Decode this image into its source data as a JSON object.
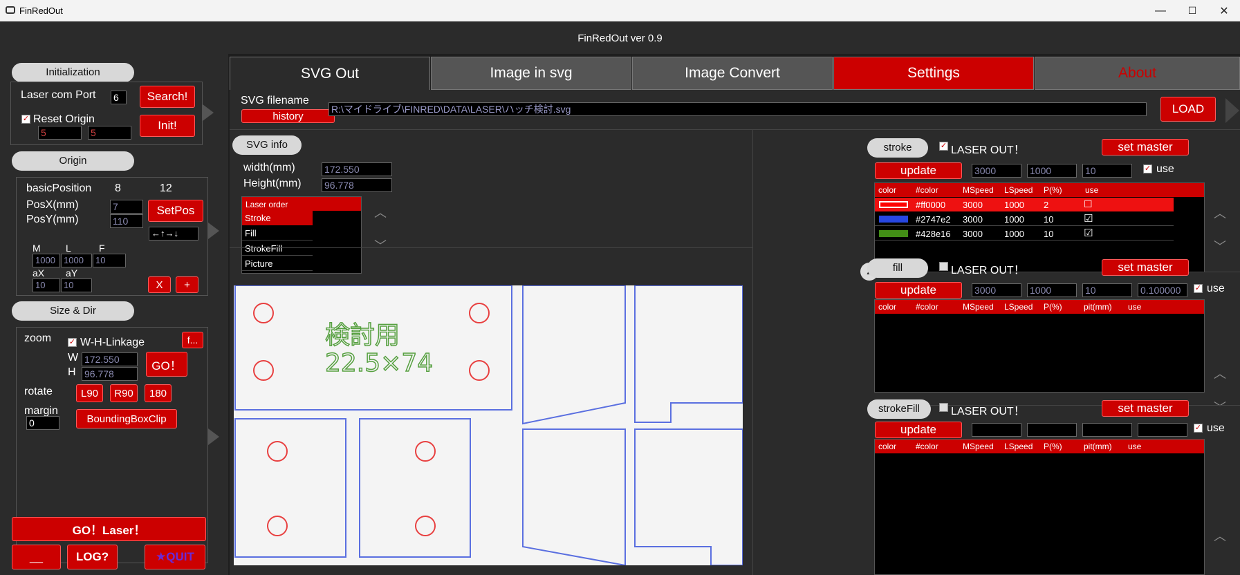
{
  "window": {
    "title": "FinRedOut",
    "min": "—",
    "max": "☐",
    "close": "✕"
  },
  "app_header": "FinRedOut ver 0.9",
  "left": {
    "initialization": "Initialization",
    "laser_com_port_label": "Laser com Port",
    "laser_com_port_value": "6",
    "search_btn": "Search!",
    "reset_origin_label": "Reset Origin",
    "reset_origin_x": "5",
    "reset_origin_y": "5",
    "init_btn": "Init!",
    "origin": "Origin",
    "basic_position_label": "basicPosition",
    "basic_position_a": "8",
    "basic_position_b": "12",
    "posx_label": "PosX(mm)",
    "posx_value": "7",
    "posy_label": "PosY(mm)",
    "posy_value": "110",
    "setpos_btn": "SetPos",
    "arrows_value": "←↑→↓",
    "m_label": "M",
    "l_label": "L",
    "f_label": "F",
    "m_value": "1000",
    "l_value": "1000",
    "f_value": "10",
    "ax_label": "aX",
    "ay_label": "aY",
    "ax_value": "10",
    "ay_value": "10",
    "x_btn": "X",
    "plus_btn": "+",
    "size_dir": "Size & Dir",
    "zoom_label": "zoom",
    "wh_linkage_label": "W-H-Linkage",
    "f_btn": "f...",
    "w_label": "W",
    "w_value": "172.550",
    "h_label": "H",
    "h_value": "96.778",
    "go_btn": "GO！",
    "rotate_label": "rotate",
    "l90_btn": "L90",
    "r90_btn": "R90",
    "r180_btn": "180",
    "margin_label": "margin",
    "margin_value": "0",
    "bbox_btn": "BoundingBoxClip",
    "go_laser_btn": "GO！Laser！",
    "underscore_btn": "__",
    "log_btn": "LOG?",
    "quit_btn": "★QUIT"
  },
  "tabs": [
    "SVG Out",
    "Image in svg",
    "Image Convert",
    "Settings",
    "About"
  ],
  "svg": {
    "filename_label": "SVG filename",
    "history_btn": "history",
    "filename_value": "R:\\マイドライブ\\FINRED\\DATA\\LASER\\ハッチ検討.svg",
    "load_btn": "LOAD",
    "svg_info": "SVG info",
    "width_label": "width(mm)",
    "width_value": "172.550",
    "height_label": "Height(mm)",
    "height_value": "96.778",
    "laser_order_header": "Laser order",
    "laser_order": [
      "Stroke",
      "Fill",
      "StrokeFill",
      "Picture"
    ],
    "preview_text_1": "検討用",
    "preview_text_2": "22.5×74"
  },
  "stroke": {
    "title": "stroke",
    "laser_out": "LASER OUT！",
    "set_master": "set master",
    "update": "update",
    "mspeed": "3000",
    "lspeed": "1000",
    "power": "10",
    "use": "use",
    "headers": [
      "color",
      "#color",
      "MSpeed",
      "LSpeed",
      "P(%)",
      "use"
    ],
    "rows": [
      {
        "swatch": "#ff0000",
        "color": "#ff0000",
        "ms": "3000",
        "ls": "1000",
        "p": "2",
        "use": "☐"
      },
      {
        "swatch": "#2747e2",
        "color": "#2747e2",
        "ms": "3000",
        "ls": "1000",
        "p": "10",
        "use": "☑"
      },
      {
        "swatch": "#428e16",
        "color": "#428e16",
        "ms": "3000",
        "ls": "1000",
        "p": "10",
        "use": "☑"
      }
    ]
  },
  "fill": {
    "title": "fill",
    "laser_out": "LASER OUT！",
    "set_master": "set master",
    "update": "update",
    "mspeed": "3000",
    "lspeed": "1000",
    "power": "10",
    "pitch": "0.100000",
    "use": "use",
    "headers": [
      "color",
      "#color",
      "MSpeed",
      "LSpeed",
      "P(%)",
      "pit(mm)",
      "use"
    ]
  },
  "strokefill": {
    "title": "strokeFill",
    "laser_out": "LASER OUT！",
    "set_master": "set master",
    "update": "update",
    "use": "use",
    "headers": [
      "color",
      "#color",
      "MSpeed",
      "LSpeed",
      "P(%)",
      "pit(mm)",
      "use"
    ]
  },
  "colors": {
    "accent": "#cc0000",
    "bg": "#2b2b2b",
    "svg_blue": "#5a6fe0",
    "svg_red": "#e84040",
    "svg_green": "#56a040"
  }
}
